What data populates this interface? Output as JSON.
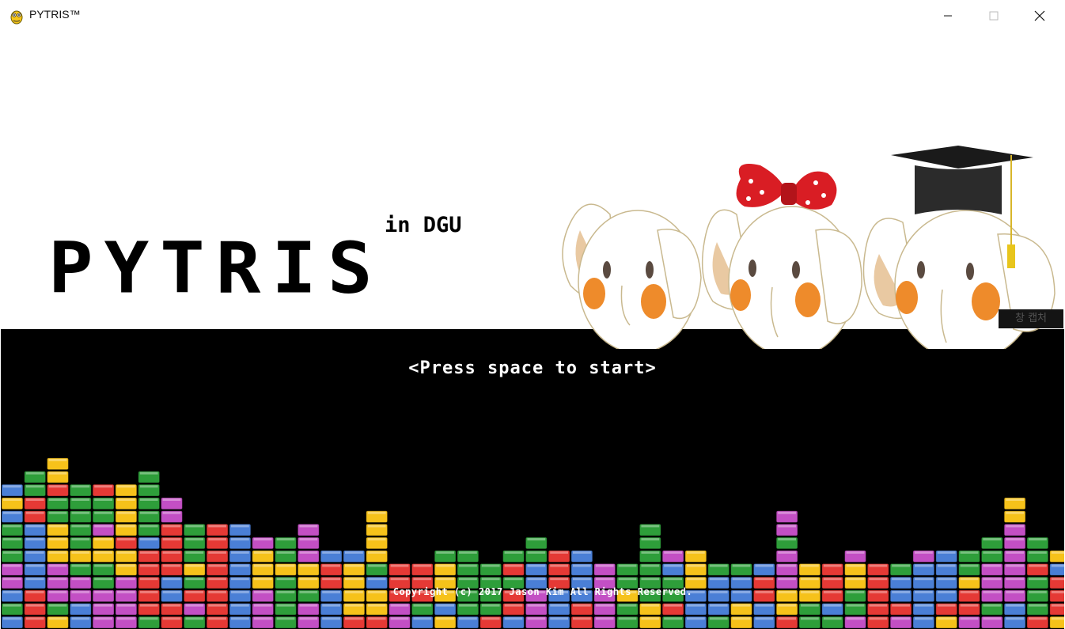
{
  "window": {
    "title": "PYTRIS™",
    "icon": "pygame-snake-icon",
    "controls": [
      "minimize",
      "maximize",
      "close"
    ]
  },
  "game": {
    "logo": "PYTRIS",
    "subtitle": "in DGU",
    "prompt": "<Press space to start>",
    "copyright": "Copyright (c) 2017 Jason Kim All Rights Reserved.",
    "colors": {
      "red": "#e53935",
      "green": "#2e9e3a",
      "blue": "#4a7fd6",
      "yellow": "#f6c21a",
      "magenta": "#c34fc4"
    }
  },
  "ime": {
    "text": "창 캡처"
  }
}
